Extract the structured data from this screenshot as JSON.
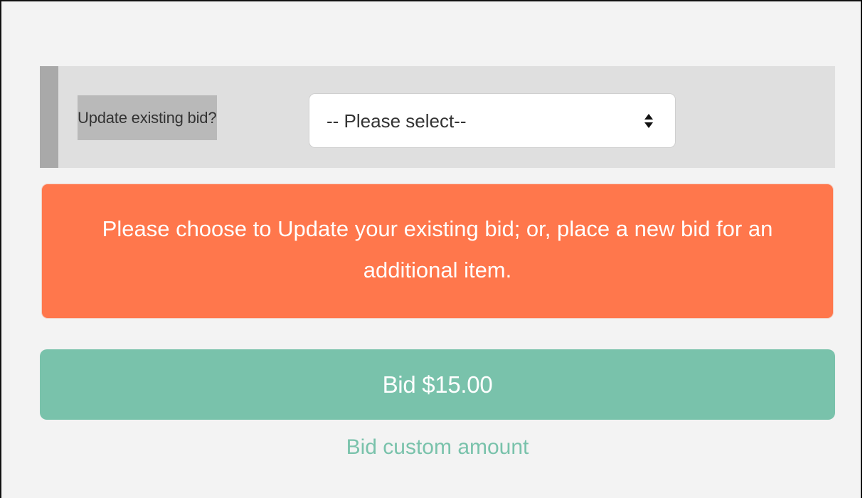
{
  "update_bid": {
    "label": "Update existing bid?",
    "select_value": "-- Please select--"
  },
  "alert": {
    "message": "Please choose to Update your existing bid; or, place a new bid for an additional item."
  },
  "bid_button": {
    "label": "Bid $15.00"
  },
  "custom_link": {
    "label": "Bid custom amount"
  },
  "colors": {
    "alert": "#ff774c",
    "primary": "#79c2ab",
    "panel": "#dfdfdf",
    "page": "#f3f3f3"
  },
  "icons": {
    "select_indicator": "sort-icon"
  }
}
